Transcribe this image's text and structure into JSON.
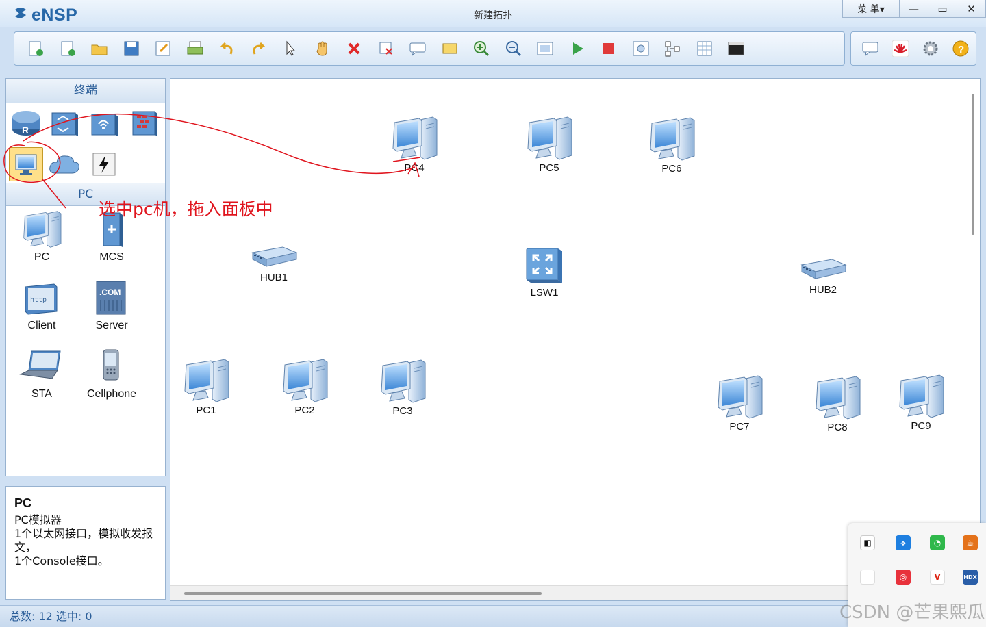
{
  "app": {
    "logo": "eNSP",
    "title": "新建拓扑"
  },
  "window_controls": {
    "menu": "菜 单▾",
    "minimize": "—",
    "maximize": "▭",
    "close": "✕"
  },
  "toolbar": {
    "left": [
      "new-topology-icon",
      "new-blank-icon",
      "open-icon",
      "save-icon",
      "save-as-icon",
      "print-icon",
      "undo-icon",
      "redo-icon",
      "select-icon",
      "pan-icon",
      "delete-icon",
      "clear-links-icon",
      "text-note-icon",
      "rectangle-icon",
      "zoom-in-icon",
      "zoom-out-icon",
      "fit-icon",
      "start-icon",
      "stop-icon",
      "capture-icon",
      "topology-icon",
      "grid-icon",
      "terminal-icon"
    ],
    "right": [
      "chat-icon",
      "huawei-icon",
      "settings-icon",
      "help-icon"
    ]
  },
  "left_panel": {
    "header": "终端",
    "subheader": "PC",
    "items": [
      {
        "label": "PC",
        "icon": "pc-icon"
      },
      {
        "label": "MCS",
        "icon": "mcs-icon"
      },
      {
        "label": "Client",
        "icon": "client-icon"
      },
      {
        "label": "Server",
        "icon": "server-icon"
      },
      {
        "label": "STA",
        "icon": "laptop-icon"
      },
      {
        "label": "Cellphone",
        "icon": "cellphone-icon"
      }
    ]
  },
  "info": {
    "title": "PC",
    "body": "PC模拟器\n1个以太网接口，模拟收发报文，\n1个Console接口。"
  },
  "annotation": "选中pc机，拖入面板中",
  "canvas": {
    "nodes": [
      {
        "label": "PC4",
        "type": "pc"
      },
      {
        "label": "PC5",
        "type": "pc"
      },
      {
        "label": "PC6",
        "type": "pc"
      },
      {
        "label": "HUB1",
        "type": "hub"
      },
      {
        "label": "LSW1",
        "type": "switch"
      },
      {
        "label": "HUB2",
        "type": "hub"
      },
      {
        "label": "PC1",
        "type": "pc"
      },
      {
        "label": "PC2",
        "type": "pc"
      },
      {
        "label": "PC3",
        "type": "pc"
      },
      {
        "label": "PC7",
        "type": "pc"
      },
      {
        "label": "PC8",
        "type": "pc"
      },
      {
        "label": "PC9",
        "type": "pc"
      }
    ]
  },
  "status": "总数: 12  选中: 0",
  "watermark": "CSDN @芒果熙瓜",
  "colors": {
    "accent": "#2b5e99",
    "annotation": "#e0151e",
    "selected": "#ffe08a"
  }
}
